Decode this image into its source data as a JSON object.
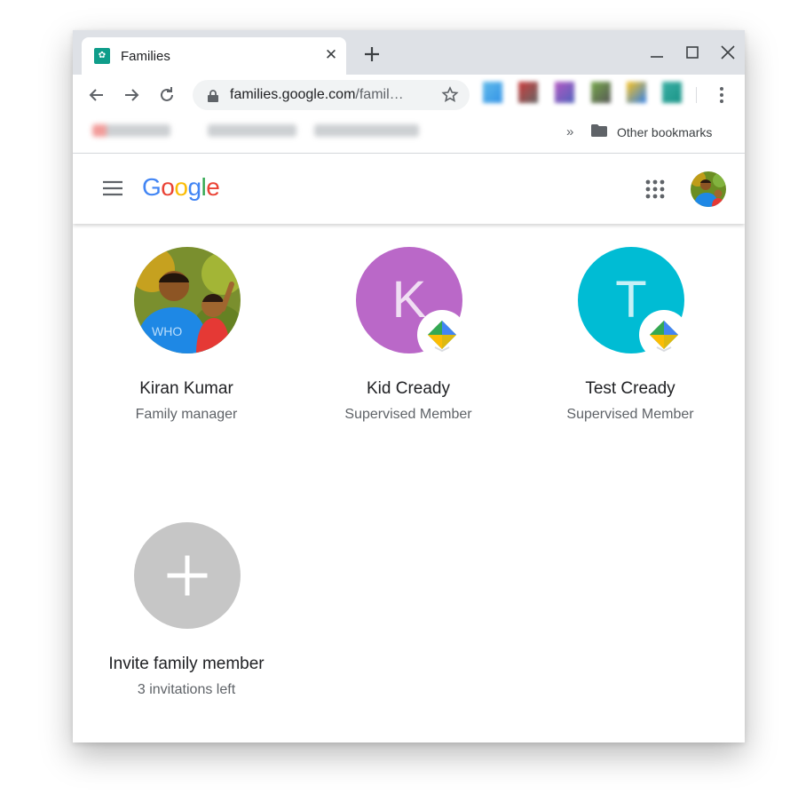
{
  "browser": {
    "tab_title": "Families",
    "url_host": "families.google.com",
    "url_rest": "/famil…",
    "other_bookmarks": "Other bookmarks"
  },
  "app": {
    "logo": "Google"
  },
  "members": [
    {
      "name": "Kiran Kumar",
      "role": "Family manager"
    },
    {
      "name": "Kid Cready",
      "role": "Supervised Member",
      "initial": "K",
      "color": "#ba68c8"
    },
    {
      "name": "Test Cready",
      "role": "Supervised Member",
      "initial": "T",
      "color": "#00bcd4"
    }
  ],
  "invite": {
    "label": "Invite family member",
    "subtitle": "3 invitations left"
  },
  "colors": {
    "google_blue": "#4285F4",
    "google_red": "#EA4335",
    "google_yellow": "#FBBC05",
    "google_green": "#34A853",
    "invite_circle": "#c6c6c6"
  }
}
